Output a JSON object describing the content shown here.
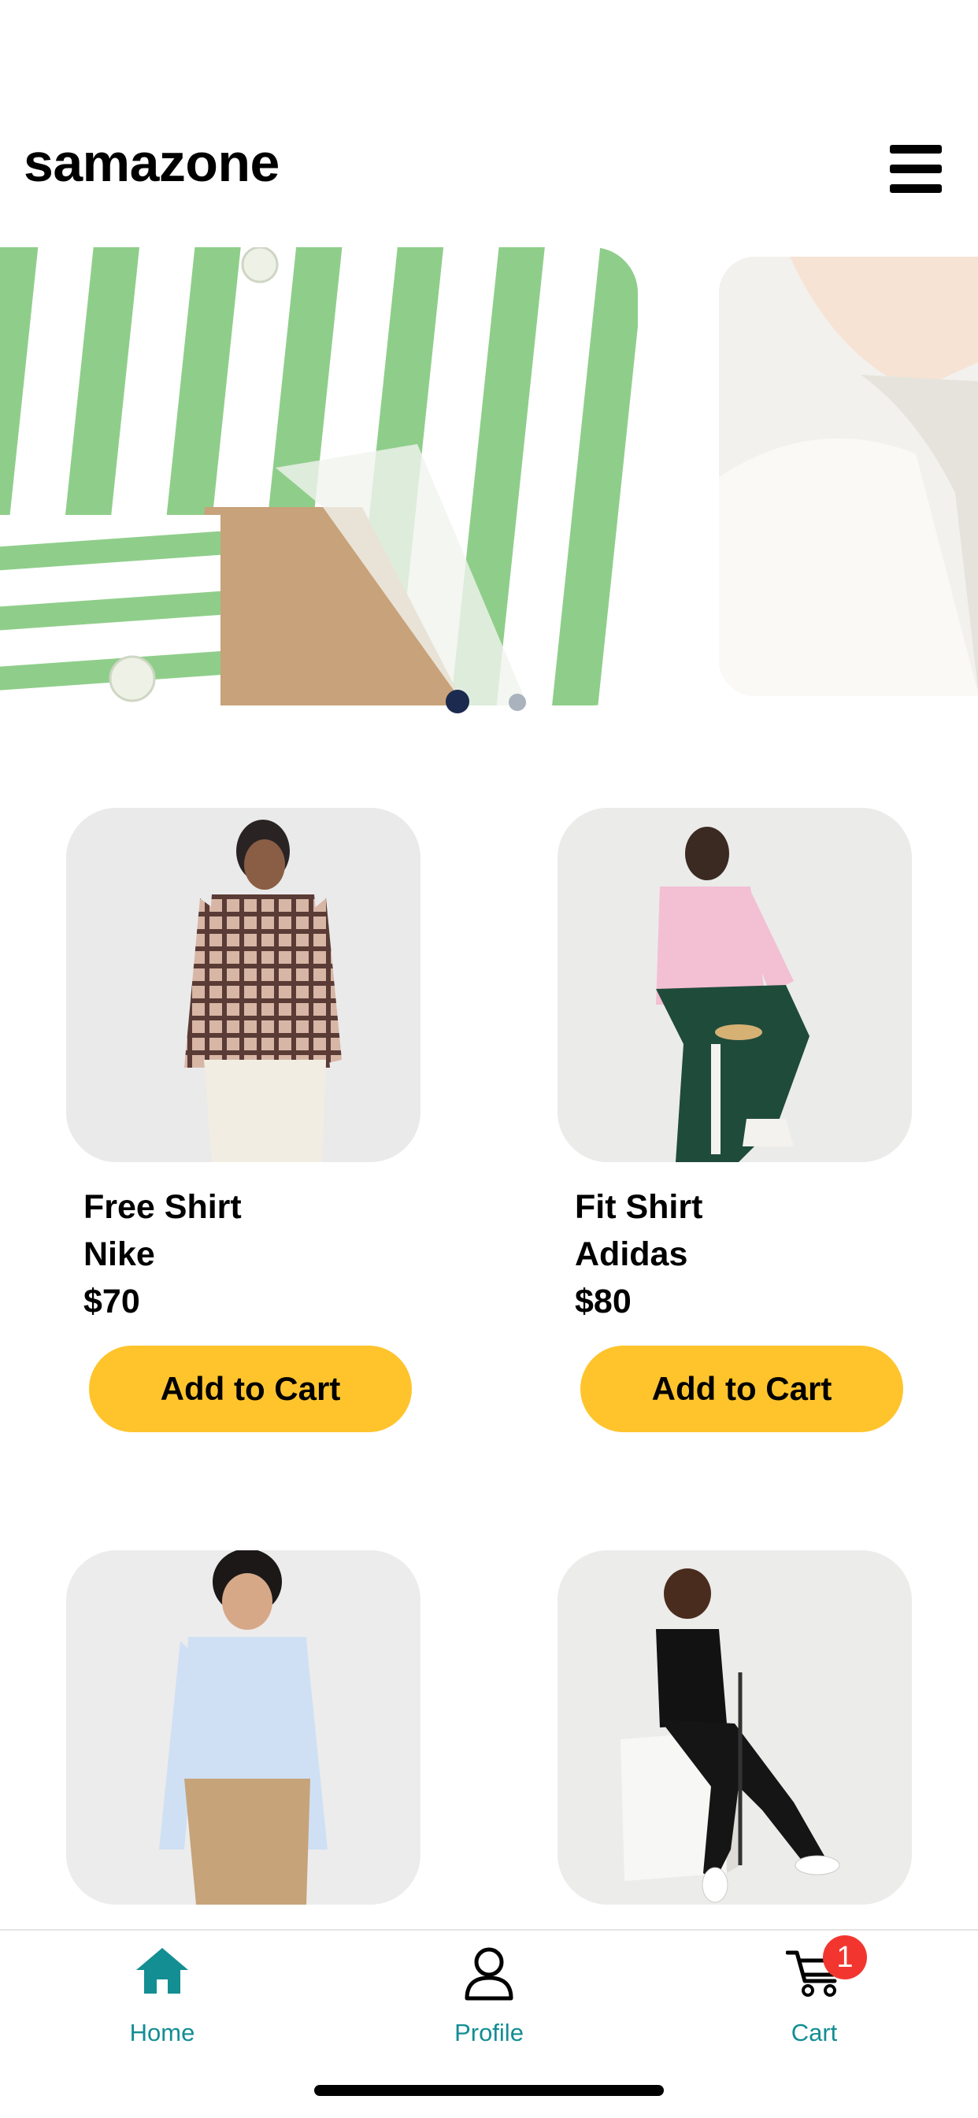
{
  "header": {
    "brand": "samazone",
    "menu_icon": "hamburger-menu-icon"
  },
  "carousel": {
    "slide_count": 2,
    "active_index": 0,
    "slides": [
      {
        "description_icon": "green-striped-shirt-image"
      },
      {
        "description_icon": "white-collar-shirt-image"
      }
    ]
  },
  "products": [
    {
      "name": "Free Shirt",
      "brand": "Nike",
      "price": "$70",
      "button": "Add to Cart",
      "image_icon": "plaid-shirt-model-image"
    },
    {
      "name": "Fit Shirt",
      "brand": "Adidas",
      "price": "$80",
      "button": "Add to Cart",
      "image_icon": "pink-shirt-model-image"
    },
    {
      "image_icon": "blue-shirt-model-image"
    },
    {
      "image_icon": "black-polo-golf-model-image"
    }
  ],
  "tabbar": {
    "tabs": [
      {
        "label": "Home",
        "icon": "home-icon",
        "active": true
      },
      {
        "label": "Profile",
        "icon": "person-icon",
        "active": false
      },
      {
        "label": "Cart",
        "icon": "cart-icon",
        "active": false
      }
    ],
    "cart_badge": "1"
  },
  "colors": {
    "accent": "#138e93",
    "button": "#ffc42c",
    "badge": "#f2362f",
    "dot_active": "#1b2a4e",
    "dot_inactive": "#aab2bd"
  }
}
